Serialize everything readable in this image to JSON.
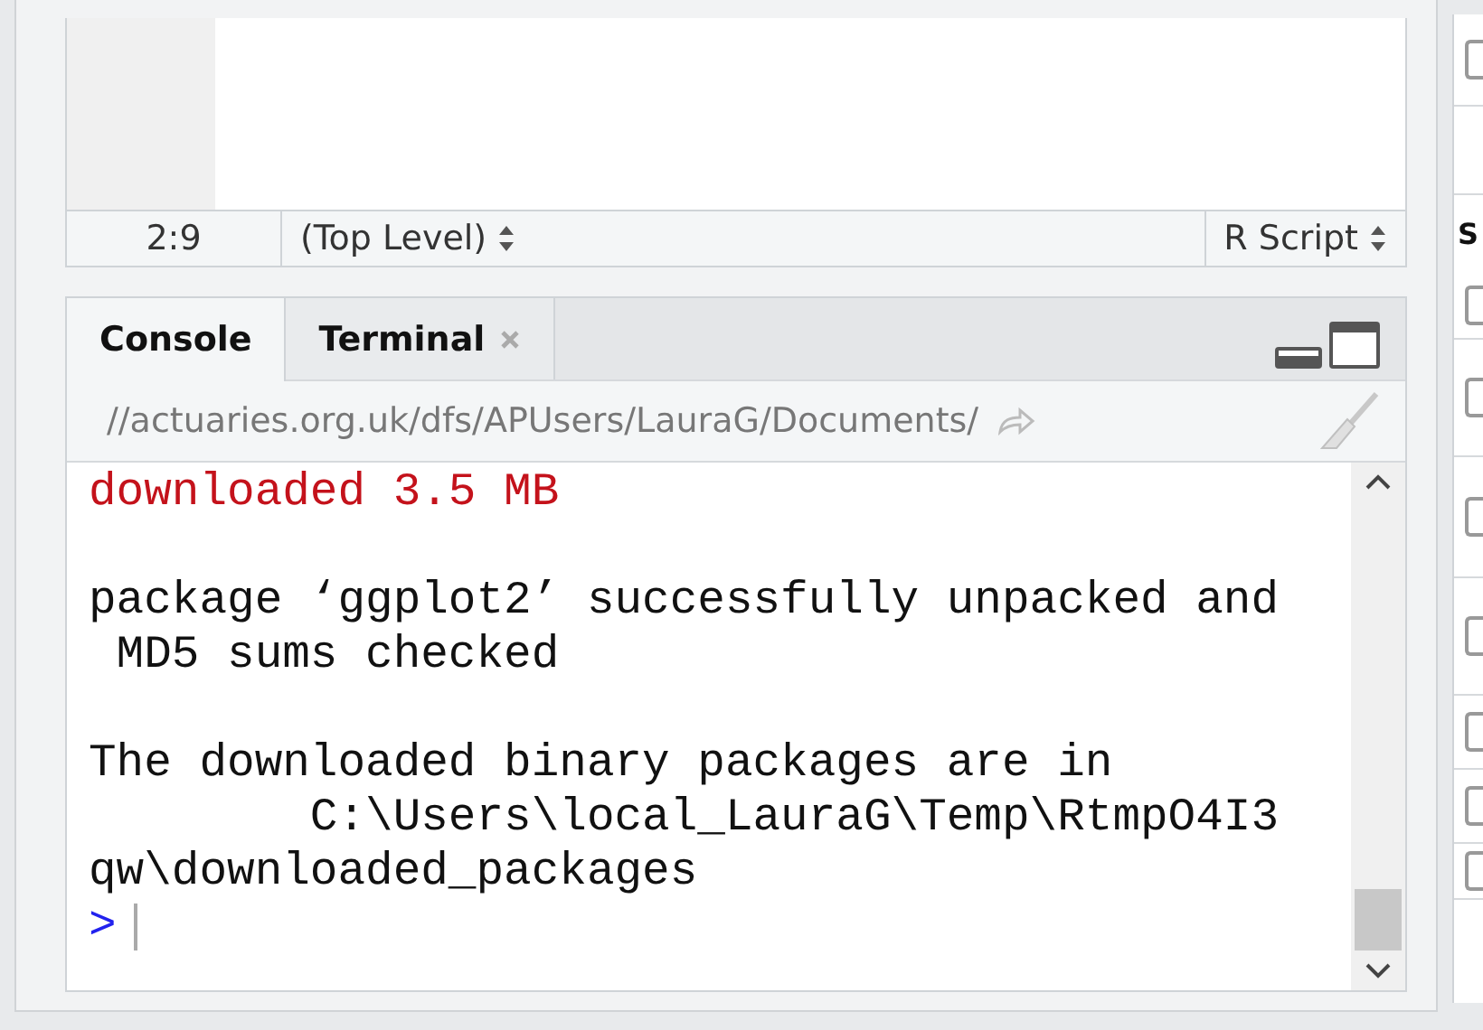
{
  "editor": {
    "status_bar": {
      "position": "2:9",
      "scope": "(Top Level)",
      "file_type": "R Script"
    }
  },
  "console_pane": {
    "tabs": [
      {
        "label": "Console",
        "selected": true,
        "closable": false
      },
      {
        "label": "Terminal",
        "selected": false,
        "closable": true
      }
    ],
    "path": "//actuaries.org.uk/dfs/APUsers/LauraG/Documents/",
    "blocks": [
      {
        "kind": "message",
        "lines": [
          "downloaded 3.5 MB"
        ]
      },
      {
        "kind": "output",
        "lines": [
          "package ‘ggplot2’ successfully unpacked and",
          " MD5 sums checked"
        ]
      },
      {
        "kind": "output",
        "lines": [
          "The downloaded binary packages are in",
          "        C:\\Users\\local_LauraG\\Temp\\RtmpO4I3",
          "qw\\downloaded_packages"
        ]
      }
    ],
    "prompt": ">"
  },
  "right_pane": {
    "heading": "S"
  }
}
